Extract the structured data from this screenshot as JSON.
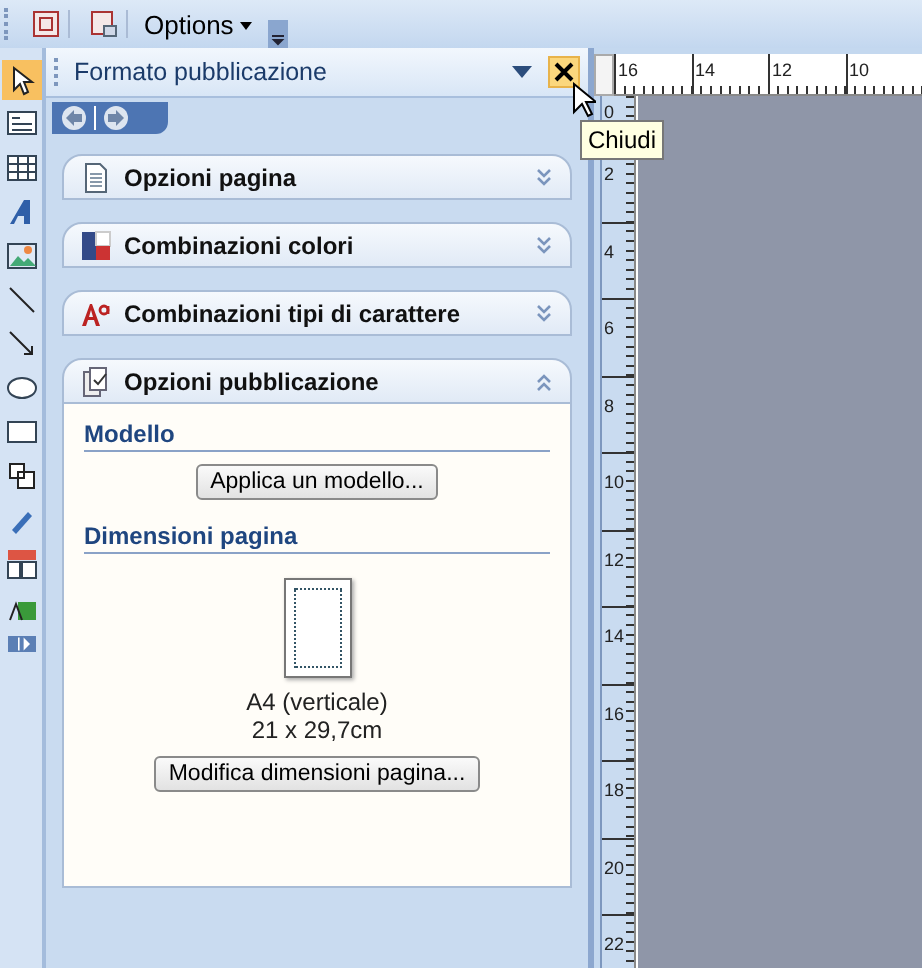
{
  "toolbar": {
    "options_button": "Options"
  },
  "task_pane": {
    "title": "Formato pubblicazione",
    "close_tooltip": "Chiudi",
    "sections": [
      {
        "title": "Opzioni pagina",
        "expanded": false
      },
      {
        "title": "Combinazioni colori",
        "expanded": false
      },
      {
        "title": "Combinazioni tipi di carattere",
        "expanded": false
      },
      {
        "title": "Opzioni pubblicazione",
        "expanded": true
      }
    ],
    "template_heading": "Modello",
    "apply_button": "Applica un modello...",
    "page_size_heading": "Dimensioni pagina",
    "page_name": "A4 (verticale)",
    "page_dimensions": "21 x 29,7cm",
    "change_size_button": "Modifica dimensioni pagina..."
  },
  "horizontal_ruler": [
    "16",
    "14",
    "12",
    "10"
  ],
  "vertical_ruler": [
    "0",
    "2",
    "4",
    "6",
    "8",
    "10",
    "12",
    "14",
    "16",
    "18",
    "20",
    "22"
  ]
}
